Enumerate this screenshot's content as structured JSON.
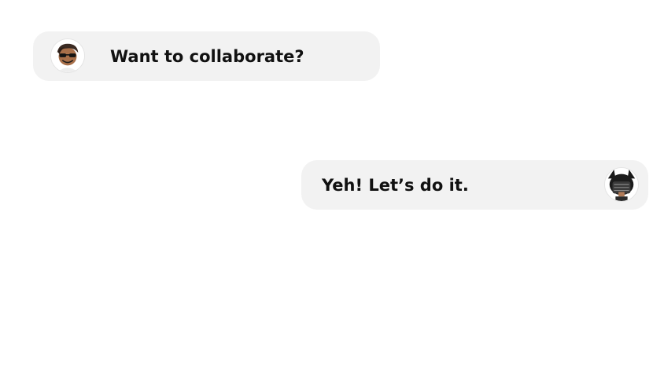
{
  "messages": [
    {
      "sender": "incoming",
      "text": "Want to collaborate?",
      "avatar_icon": "user-avatar-sunglasses-icon"
    },
    {
      "sender": "outgoing",
      "text": "Yeh! Let’s do it.",
      "avatar_icon": "user-avatar-dark-hair-icon"
    }
  ],
  "colors": {
    "bubble_background": "#f2f2f2",
    "text": "#111111",
    "page_background": "#ffffff"
  }
}
